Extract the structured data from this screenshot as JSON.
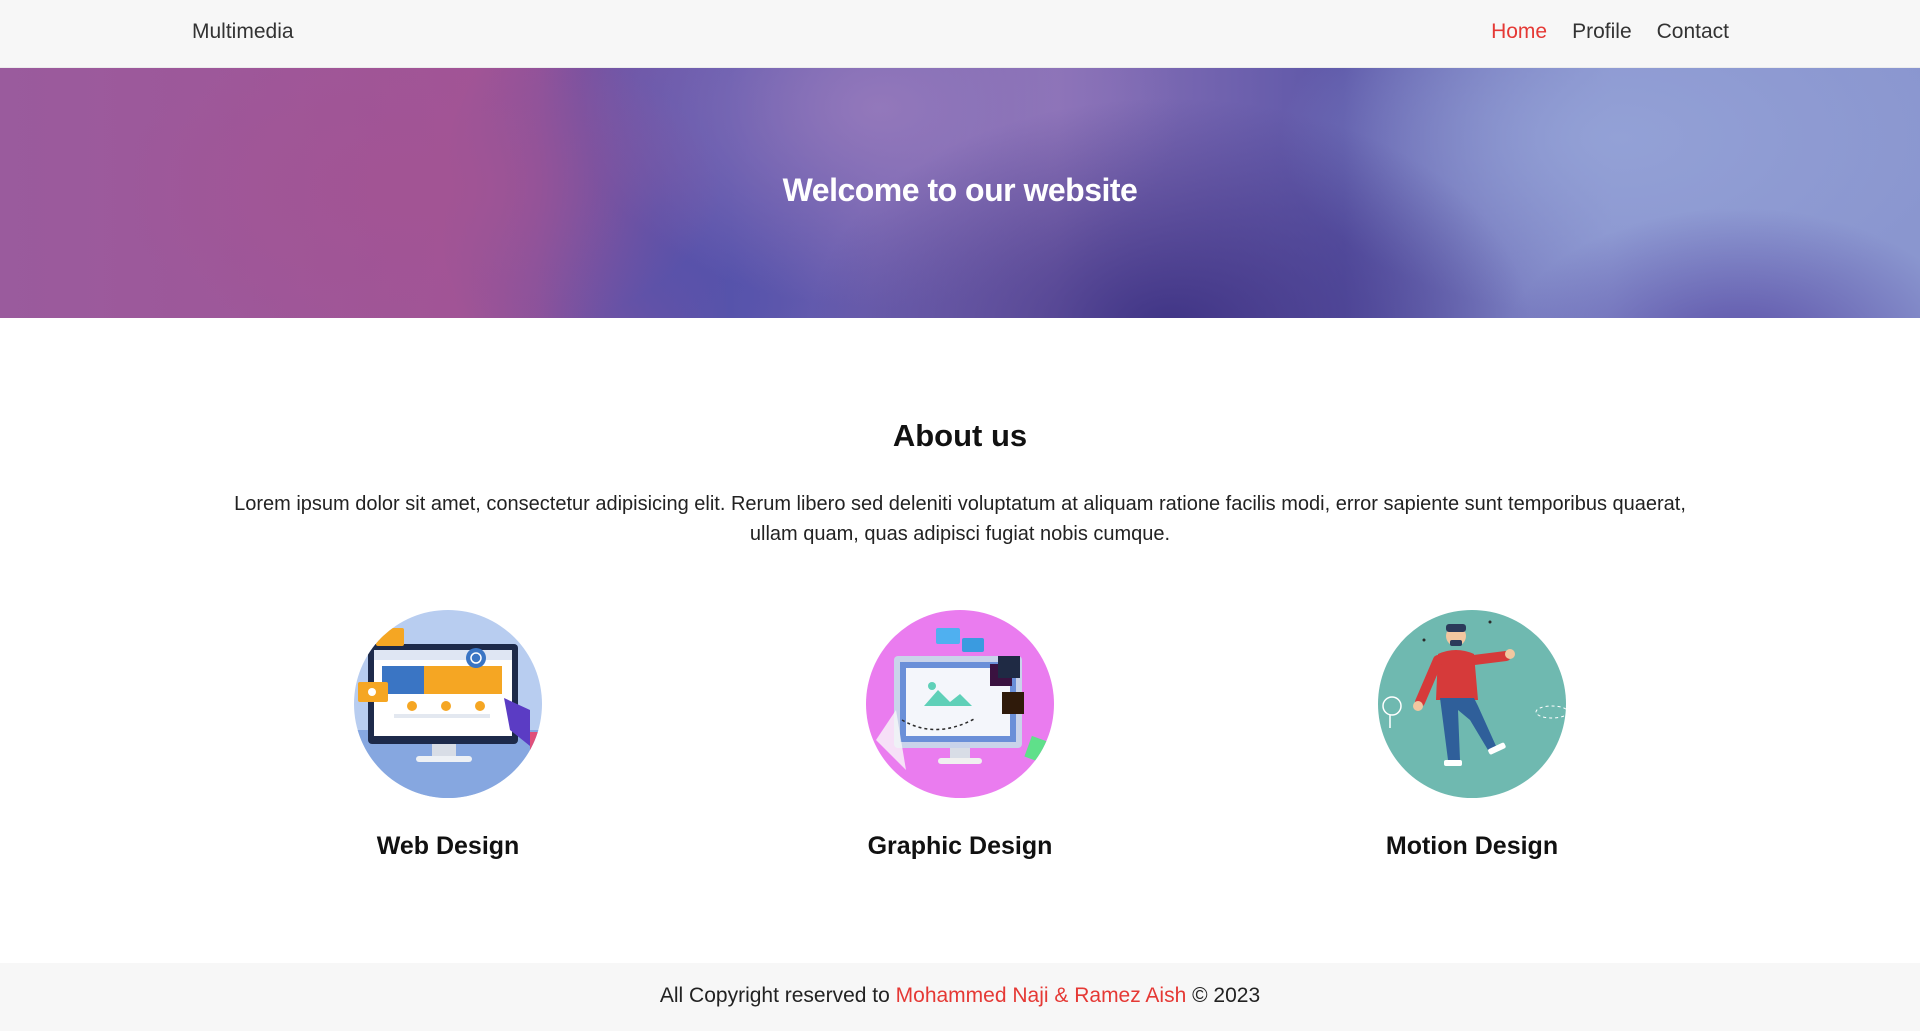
{
  "navbar": {
    "brand": "Multimedia",
    "links": [
      {
        "label": "Home",
        "active": true
      },
      {
        "label": "Profile",
        "active": false
      },
      {
        "label": "Contact",
        "active": false
      }
    ]
  },
  "hero": {
    "title": "Welcome to our website"
  },
  "about": {
    "title": "About us",
    "text": "Lorem ipsum dolor sit amet, consectetur adipisicing elit. Rerum libero sed deleniti voluptatum at aliquam ratione facilis modi, error sapiente sunt temporibus quaerat, ullam quam, quas adipisci fugiat nobis cumque."
  },
  "services": [
    {
      "label": "Web Design",
      "icon": "web-design-illustration",
      "circle_color": "#b8cdf0"
    },
    {
      "label": "Graphic Design",
      "icon": "graphic-design-illustration",
      "circle_color": "#ea7cef"
    },
    {
      "label": "Motion Design",
      "icon": "motion-design-illustration",
      "circle_color": "#6fb9b0"
    }
  ],
  "footer": {
    "prefix": "All Copyright reserved to ",
    "authors": "Mohammed Naji & Ramez Aish",
    "suffix": " © 2023"
  },
  "colors": {
    "accent": "#e53935",
    "nav_background": "#f7f7f7"
  }
}
